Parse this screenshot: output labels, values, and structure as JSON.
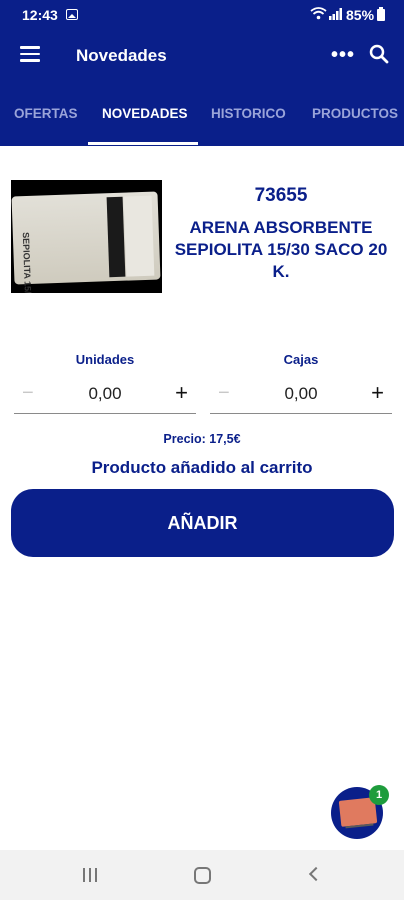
{
  "status_bar": {
    "time": "12:43",
    "battery": "85%"
  },
  "app_bar": {
    "title": "Novedades",
    "menu_icon": "hamburger-icon",
    "more_icon": "more-icon",
    "search_icon": "search-icon"
  },
  "tabs": [
    {
      "label": "OFERTAS",
      "active": false
    },
    {
      "label": "NOVEDADES",
      "active": true
    },
    {
      "label": "HISTORICO",
      "active": false
    },
    {
      "label": "PRODUCTOS",
      "active": false
    }
  ],
  "product": {
    "code": "73655",
    "name": "ARENA ABSORBENTE SEPIOLITA 15/30 SACO 20 K.",
    "image_label": "SEPIOLITA 15/30"
  },
  "quantity": {
    "units_label": "Unidades",
    "units_value": "0,00",
    "boxes_label": "Cajas",
    "boxes_value": "0,00",
    "minus": "−",
    "plus": "+"
  },
  "price": "Precio: 17,5€",
  "added_message": "Producto añadido al carrito",
  "add_button": "AÑADIR",
  "cart_badge": "1",
  "colors": {
    "primary": "#0a1f8a",
    "badge": "#1e9c3c",
    "tab_inactive": "#9aa4d9"
  }
}
